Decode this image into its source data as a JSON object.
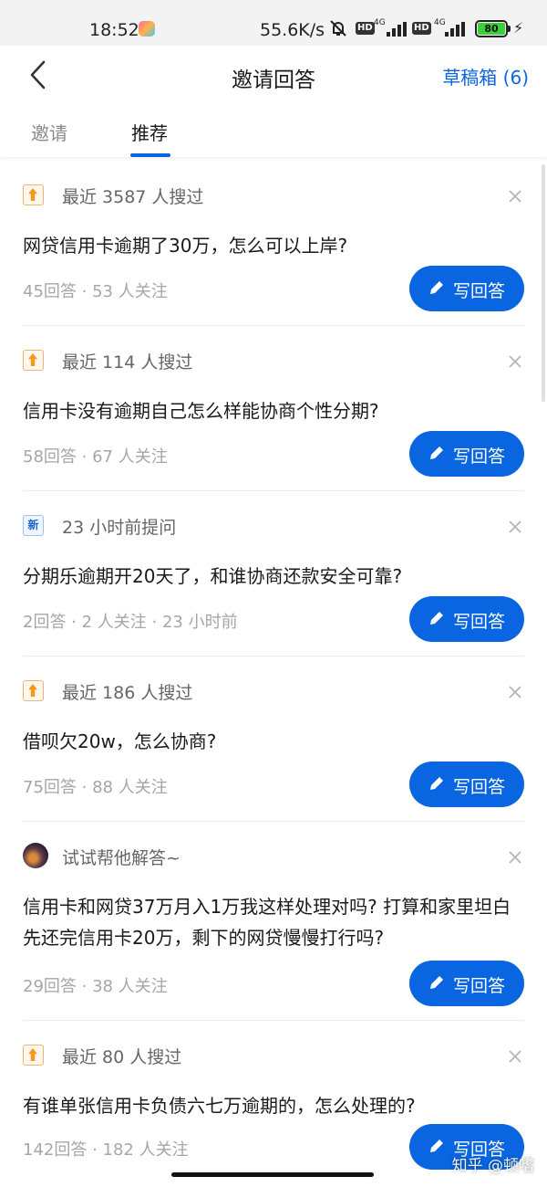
{
  "status_bar": {
    "time": "18:52",
    "speed": "55.6K/s",
    "hd1": "HD",
    "net1": "4G",
    "hd2": "HD",
    "net2": "4G",
    "battery": "80"
  },
  "nav": {
    "title": "邀请回答",
    "drafts": "草稿箱 (6)"
  },
  "tabs": [
    {
      "label": "邀请"
    },
    {
      "label": "推荐"
    }
  ],
  "questions": [
    {
      "badge": "hot",
      "head": "最近 3587 人搜过",
      "title": "网贷信用卡逾期了30万，怎么可以上岸?",
      "meta": "45回答 · 53 人关注",
      "button": "写回答"
    },
    {
      "badge": "hot",
      "head": "最近 114 人搜过",
      "title": "信用卡没有逾期自己怎么样能协商个性分期?",
      "meta": "58回答 · 67 人关注",
      "button": "写回答"
    },
    {
      "badge": "new",
      "badge_text": "新",
      "head": "23 小时前提问",
      "title": "分期乐逾期开20天了，和谁协商还款安全可靠?",
      "meta": "2回答 · 2 人关注 · 23 小时前",
      "button": "写回答"
    },
    {
      "badge": "hot",
      "head": "最近 186 人搜过",
      "title": "借呗欠20w，怎么协商?",
      "meta": "75回答 · 88 人关注",
      "button": "写回答"
    },
    {
      "badge": "avatar",
      "head": "试试帮他解答~",
      "title": "信用卡和网贷37万月入1万我这样处理对吗? 打算和家里坦白先还完信用卡20万，剩下的网贷慢慢打行吗?",
      "meta": "29回答 · 38 人关注",
      "button": "写回答"
    },
    {
      "badge": "hot",
      "head": "最近 80 人搜过",
      "title": "有谁单张信用卡负债六七万逾期的，怎么处理的?",
      "meta": "142回答 · 182 人关注",
      "button": "写回答"
    }
  ],
  "watermark": "知乎 @顿嗜",
  "colors": {
    "accent": "#0a66e0",
    "hot": "#f39a1e"
  }
}
